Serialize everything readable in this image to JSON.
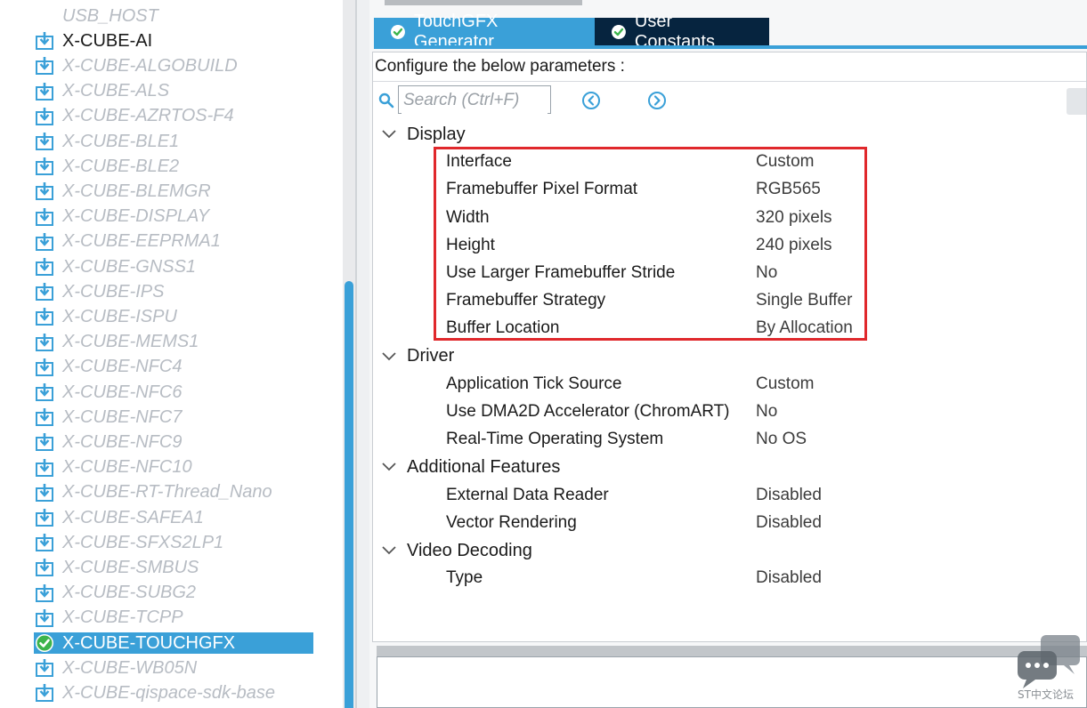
{
  "packages": {
    "items": [
      {
        "label": "USB_HOST",
        "state": "disabled",
        "icon": "none"
      },
      {
        "label": "X-CUBE-AI",
        "state": "enabled",
        "icon": "download-icon"
      },
      {
        "label": "X-CUBE-ALGOBUILD",
        "state": "disabled",
        "icon": "download-icon"
      },
      {
        "label": "X-CUBE-ALS",
        "state": "disabled",
        "icon": "download-icon"
      },
      {
        "label": "X-CUBE-AZRTOS-F4",
        "state": "disabled",
        "icon": "download-icon"
      },
      {
        "label": "X-CUBE-BLE1",
        "state": "disabled",
        "icon": "download-icon"
      },
      {
        "label": "X-CUBE-BLE2",
        "state": "disabled",
        "icon": "download-icon"
      },
      {
        "label": "X-CUBE-BLEMGR",
        "state": "disabled",
        "icon": "download-icon"
      },
      {
        "label": "X-CUBE-DISPLAY",
        "state": "disabled",
        "icon": "download-icon"
      },
      {
        "label": "X-CUBE-EEPRMA1",
        "state": "disabled",
        "icon": "download-icon"
      },
      {
        "label": "X-CUBE-GNSS1",
        "state": "disabled",
        "icon": "download-icon"
      },
      {
        "label": "X-CUBE-IPS",
        "state": "disabled",
        "icon": "download-icon"
      },
      {
        "label": "X-CUBE-ISPU",
        "state": "disabled",
        "icon": "download-icon"
      },
      {
        "label": "X-CUBE-MEMS1",
        "state": "disabled",
        "icon": "download-icon"
      },
      {
        "label": "X-CUBE-NFC4",
        "state": "disabled",
        "icon": "download-icon"
      },
      {
        "label": "X-CUBE-NFC6",
        "state": "disabled",
        "icon": "download-icon"
      },
      {
        "label": "X-CUBE-NFC7",
        "state": "disabled",
        "icon": "download-icon"
      },
      {
        "label": "X-CUBE-NFC9",
        "state": "disabled",
        "icon": "download-icon"
      },
      {
        "label": "X-CUBE-NFC10",
        "state": "disabled",
        "icon": "download-icon"
      },
      {
        "label": "X-CUBE-RT-Thread_Nano",
        "state": "disabled",
        "icon": "download-icon"
      },
      {
        "label": "X-CUBE-SAFEA1",
        "state": "disabled",
        "icon": "download-icon"
      },
      {
        "label": "X-CUBE-SFXS2LP1",
        "state": "disabled",
        "icon": "download-icon"
      },
      {
        "label": "X-CUBE-SMBUS",
        "state": "disabled",
        "icon": "download-icon"
      },
      {
        "label": "X-CUBE-SUBG2",
        "state": "disabled",
        "icon": "download-icon"
      },
      {
        "label": "X-CUBE-TCPP",
        "state": "disabled",
        "icon": "download-icon"
      },
      {
        "label": "X-CUBE-TOUCHGFX",
        "state": "selected",
        "icon": "check-circle-icon"
      },
      {
        "label": "X-CUBE-WB05N",
        "state": "disabled",
        "icon": "download-icon"
      },
      {
        "label": "X-CUBE-qispace-sdk-base",
        "state": "disabled",
        "icon": "download-icon"
      }
    ]
  },
  "tabs": [
    {
      "label": "TouchGFX Generator",
      "active": true,
      "icon": "check-circle-icon"
    },
    {
      "label": "User Constants",
      "active": false,
      "icon": "check-circle-icon"
    }
  ],
  "config": {
    "header": "Configure the below parameters :",
    "search_placeholder": "Search (Ctrl+F)",
    "groups": [
      {
        "title": "Display",
        "params": [
          {
            "name": "Interface",
            "value": "Custom"
          },
          {
            "name": "Framebuffer Pixel Format",
            "value": "RGB565"
          },
          {
            "name": "Width",
            "value": "320 pixels"
          },
          {
            "name": "Height",
            "value": "240 pixels"
          },
          {
            "name": "Use Larger Framebuffer Stride",
            "value": "No"
          },
          {
            "name": "Framebuffer Strategy",
            "value": "Single Buffer"
          },
          {
            "name": "Buffer Location",
            "value": "By Allocation"
          }
        ]
      },
      {
        "title": "Driver",
        "params": [
          {
            "name": "Application Tick Source",
            "value": "Custom"
          },
          {
            "name": "Use DMA2D Accelerator (ChromART)",
            "value": "No"
          },
          {
            "name": "Real-Time Operating System",
            "value": "No OS"
          }
        ]
      },
      {
        "title": "Additional Features",
        "params": [
          {
            "name": "External Data Reader",
            "value": "Disabled"
          },
          {
            "name": "Vector Rendering",
            "value": "Disabled"
          }
        ]
      },
      {
        "title": "Video Decoding",
        "params": [
          {
            "name": "Type",
            "value": "Disabled"
          }
        ]
      }
    ]
  },
  "watermark": {
    "text": "ST中文论坛"
  },
  "colors": {
    "accent": "#3aa0d8",
    "tab_dark": "#06243f",
    "highlight": "#e0282c",
    "icon_blue": "#3aa0d8",
    "check_green": "#3cb44b"
  }
}
